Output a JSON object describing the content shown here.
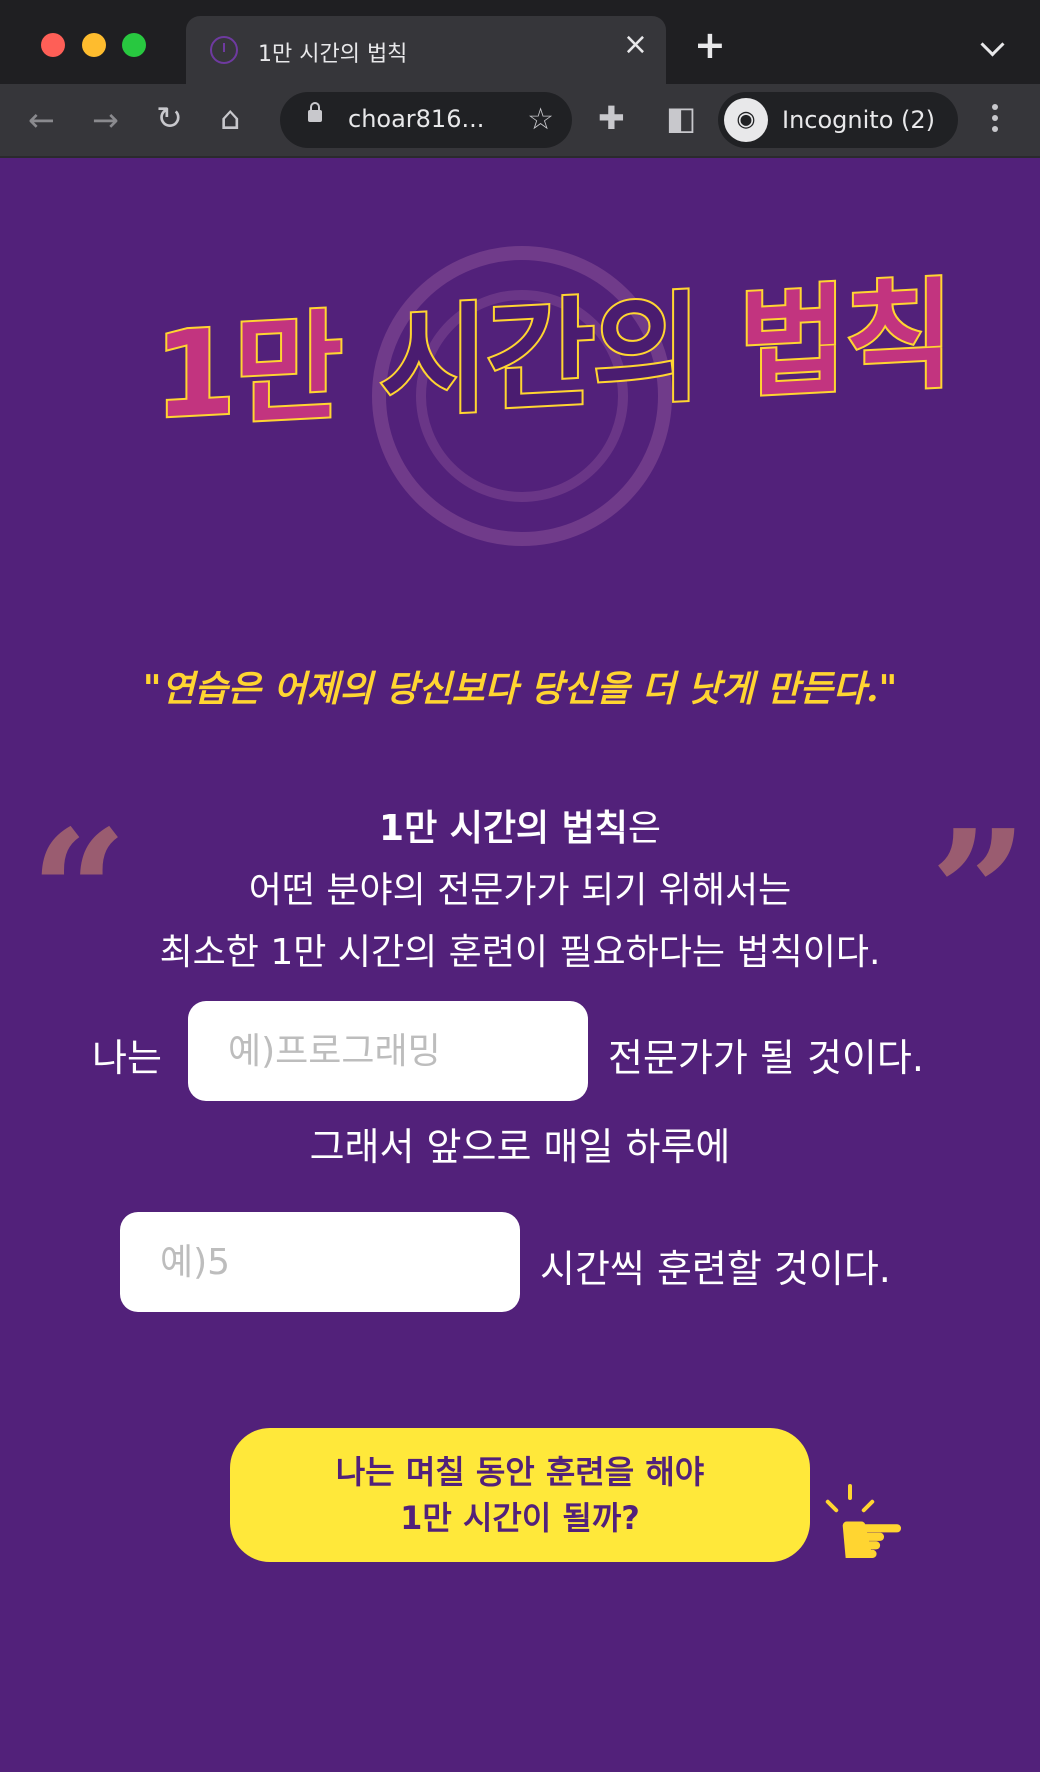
{
  "browser": {
    "tab_title": "1만 시간의 법칙",
    "url": "choar816...",
    "incognito_label": "Incognito (2)"
  },
  "page": {
    "logo": {
      "part_a": "1만",
      "part_b": " 시간의 ",
      "part_c": "법칙"
    },
    "quote": "\"연습은 어제의 당신보다 당신을 더 낫게 만든다.\"",
    "definition": {
      "bold": "1만 시간의 법칙",
      "suffix": "은",
      "line2": "어떤 분야의 전문가가 되기 위해서는",
      "line3": "최소한 1만 시간의 훈련이 필요하다는 법칙이다."
    },
    "form": {
      "row1_prefix": "나는",
      "field_placeholder": "예)프로그래밍",
      "row1_suffix": "전문가가 될 것이다.",
      "row2_text": "그래서 앞으로 매일 하루에",
      "hours_placeholder": "예)5",
      "row3_suffix": "시간씩 훈련할 것이다."
    },
    "cta": {
      "line1": "나는 며칠 동안 훈련을 해야",
      "line2": "1만 시간이 될까?"
    }
  },
  "colors": {
    "background": "#52217a",
    "accent_yellow": "#ffd531",
    "accent_pink": "#c2347f",
    "button_yellow": "#ffe83a"
  }
}
